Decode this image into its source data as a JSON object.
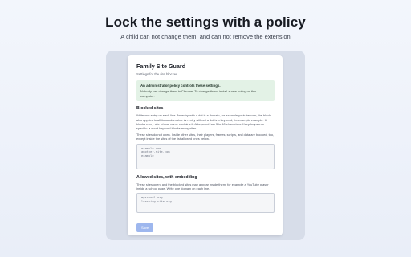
{
  "hero": {
    "title": "Lock the settings with a policy",
    "subtitle": "A child can not change them, and can not remove the extension"
  },
  "settings": {
    "title": "Family Site Guard",
    "subtitle": "Settings for the site blocker.",
    "notice": {
      "title": "An administrator policy controls these settings.",
      "body": "Nobody can change them in Chrome. To change them, install a new policy on this computer."
    },
    "blocked": {
      "title": "Blocked sites",
      "description": "Write one entry on each line. An entry with a dot is a domain, for example youtube.com, the block also applies to all its subdomains. An entry without a dot is a keyword, for example example. It blocks every site whose name contains it. A keyword has 3 to 40 characters. Keep keywords specific: a short keyword blocks many sites.",
      "note": "These sites do not open. Inside other sites, their players, frames, scripts, and data are blocked, too, except inside the sites of the list allowed ones below.",
      "entries": [
        "example.com",
        "another-site.com",
        "example"
      ]
    },
    "allowed": {
      "title": "Allowed sites, with embedding",
      "description": "These sites open, and the blocked sites may appear inside them, for example a YouTube player inside a school page. Write one domain on each line.",
      "entries": [
        "myschool.org",
        "learning-site.org"
      ]
    },
    "save_label": "Save"
  }
}
